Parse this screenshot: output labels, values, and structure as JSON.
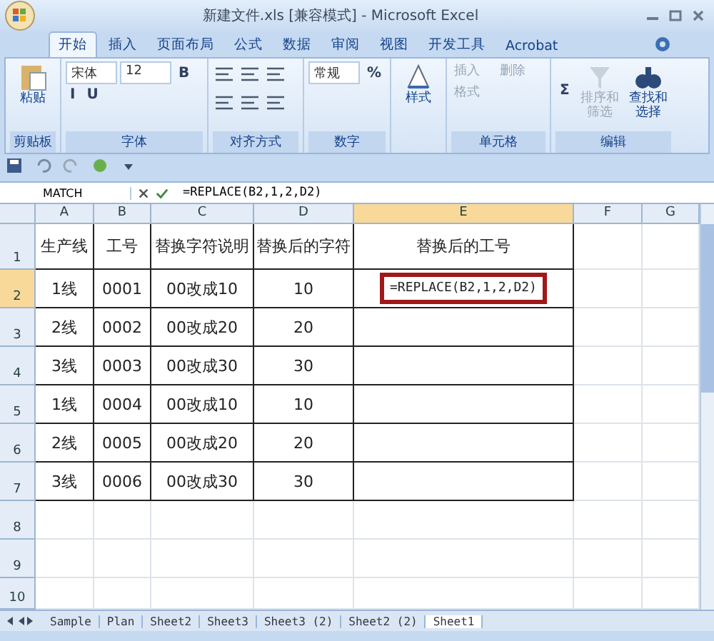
{
  "window": {
    "title": "新建文件.xls [兼容模式] - Microsoft Excel"
  },
  "tabs": [
    {
      "label": "开始",
      "selected": true
    },
    {
      "label": "插入",
      "selected": false
    },
    {
      "label": "页面布局",
      "selected": false
    },
    {
      "label": "公式",
      "selected": false
    },
    {
      "label": "数据",
      "selected": false
    },
    {
      "label": "审阅",
      "selected": false
    },
    {
      "label": "视图",
      "selected": false
    },
    {
      "label": "开发工具",
      "selected": false
    },
    {
      "label": "Acrobat",
      "selected": false
    }
  ],
  "ribbon": [
    {
      "label": "剪贴板",
      "items": [
        {
          "kind": "big",
          "label": "粘贴",
          "disabled": false
        }
      ]
    },
    {
      "label": "字体",
      "items": [
        {
          "kind": "field",
          "value": "宋体"
        },
        {
          "kind": "field",
          "value": "12"
        },
        {
          "kind": "glyph",
          "label": "B"
        },
        {
          "kind": "glyph",
          "label": "I"
        },
        {
          "kind": "glyph",
          "label": "U"
        }
      ]
    },
    {
      "label": "对齐方式",
      "items": [
        {
          "kind": "align"
        },
        {
          "kind": "align"
        },
        {
          "kind": "align"
        },
        {
          "kind": "align"
        },
        {
          "kind": "align"
        },
        {
          "kind": "align"
        }
      ]
    },
    {
      "label": "数字",
      "items": [
        {
          "kind": "field",
          "value": "常规"
        },
        {
          "kind": "glyph",
          "label": "%"
        }
      ]
    },
    {
      "items": [
        {
          "kind": "big",
          "label": "样式",
          "disabled": false
        }
      ]
    },
    {
      "label": "单元格",
      "items": [
        {
          "kind": "small",
          "label": "插入",
          "disabled": true
        },
        {
          "kind": "small",
          "label": "删除",
          "disabled": true
        },
        {
          "kind": "small",
          "label": "格式",
          "disabled": true
        }
      ]
    },
    {
      "label": "编辑",
      "items": [
        {
          "kind": "glyph",
          "label": "Σ"
        },
        {
          "kind": "big",
          "label": "排序和筛选",
          "disabled": true
        },
        {
          "kind": "big",
          "label": "查找和选择",
          "disabled": false
        }
      ]
    }
  ],
  "formula_bar": {
    "name_box": "MATCH",
    "formula": "=REPLACE(B2,1,2,D2)"
  },
  "table": {
    "columns": [
      {
        "label": "A",
        "selected": false
      },
      {
        "label": "B",
        "selected": false
      },
      {
        "label": "C",
        "selected": false
      },
      {
        "label": "D",
        "selected": false
      },
      {
        "label": "E",
        "selected": true
      },
      {
        "label": "F",
        "selected": false
      },
      {
        "label": "G",
        "selected": false
      }
    ],
    "rows": [
      {
        "header": "1",
        "selected": false,
        "cells": [
          "生产线",
          "工号",
          "替换字符说明",
          "替换后的字符",
          "替换后的工号"
        ]
      },
      {
        "header": "2",
        "selected": true,
        "cells": [
          "1线",
          "0001",
          "00改成10",
          "10",
          "=REPLACE(B2,1,2,D2)"
        ],
        "highlighted": true
      },
      {
        "header": "3",
        "selected": false,
        "cells": [
          "2线",
          "0002",
          "00改成20",
          "20"
        ]
      },
      {
        "header": "4",
        "selected": false,
        "cells": [
          "3线",
          "0003",
          "00改成30",
          "30"
        ]
      },
      {
        "header": "5",
        "selected": false,
        "cells": [
          "1线",
          "0004",
          "00改成10",
          "10"
        ]
      },
      {
        "header": "6",
        "selected": false,
        "cells": [
          "2线",
          "0005",
          "00改成20",
          "20"
        ]
      },
      {
        "header": "7",
        "selected": false,
        "cells": [
          "3线",
          "0006",
          "00改成30",
          "30"
        ]
      }
    ],
    "empty_rows": [
      "8",
      "9",
      "10"
    ]
  },
  "sheet_tabs": [
    {
      "label": "Sample",
      "selected": false
    },
    {
      "label": "Plan",
      "selected": false
    },
    {
      "label": "Sheet2",
      "selected": false
    },
    {
      "label": "Sheet3",
      "selected": false
    },
    {
      "label": "Sheet3 (2)",
      "selected": false
    },
    {
      "label": "Sheet2 (2)",
      "selected": false
    },
    {
      "label": "Sheet1",
      "selected": true
    }
  ]
}
